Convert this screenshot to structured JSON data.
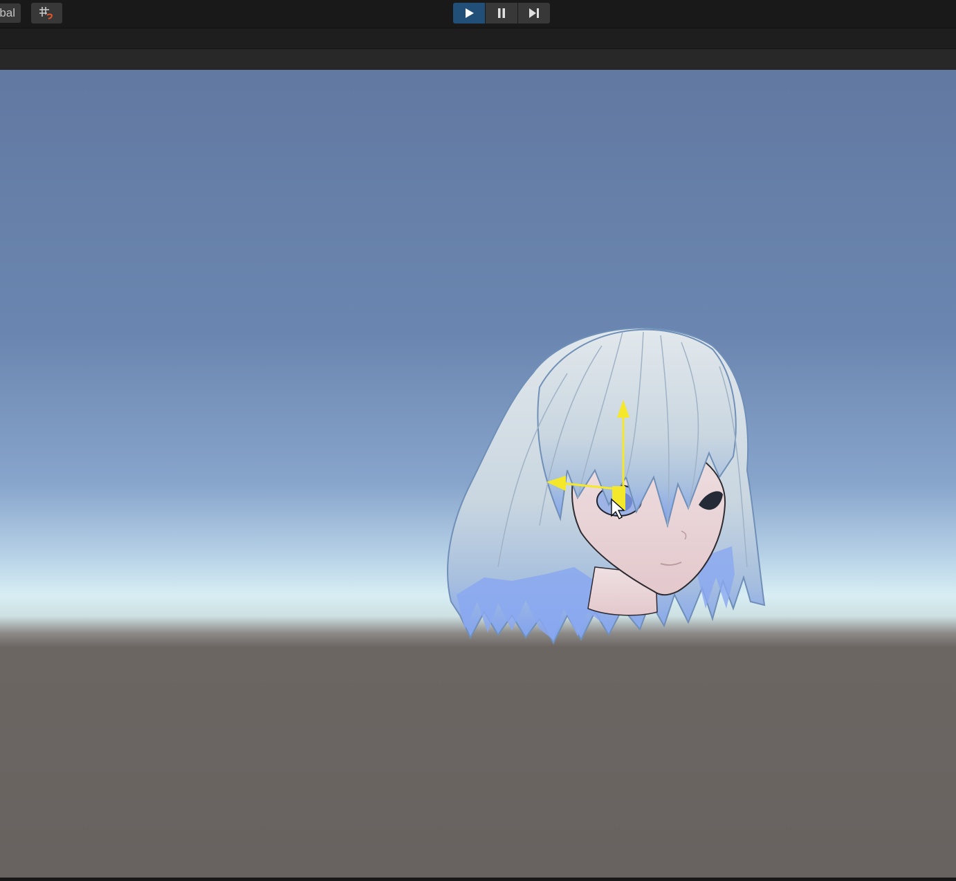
{
  "toolbar": {
    "pivot_label": "bal",
    "snap_icon": "grid-snap-icon",
    "play_controls": {
      "play_icon": "play-icon",
      "pause_icon": "pause-icon",
      "step_icon": "step-icon",
      "active": "play"
    }
  },
  "scene": {
    "object": "anime-head-model",
    "gizmo": "move-tool-gizmo",
    "gizmo_color": "#f5e82a",
    "sky_top_color": "#6279a1",
    "horizon_color": "#d8eef4",
    "ground_color": "#686260",
    "cursor": "pointer-cursor"
  }
}
